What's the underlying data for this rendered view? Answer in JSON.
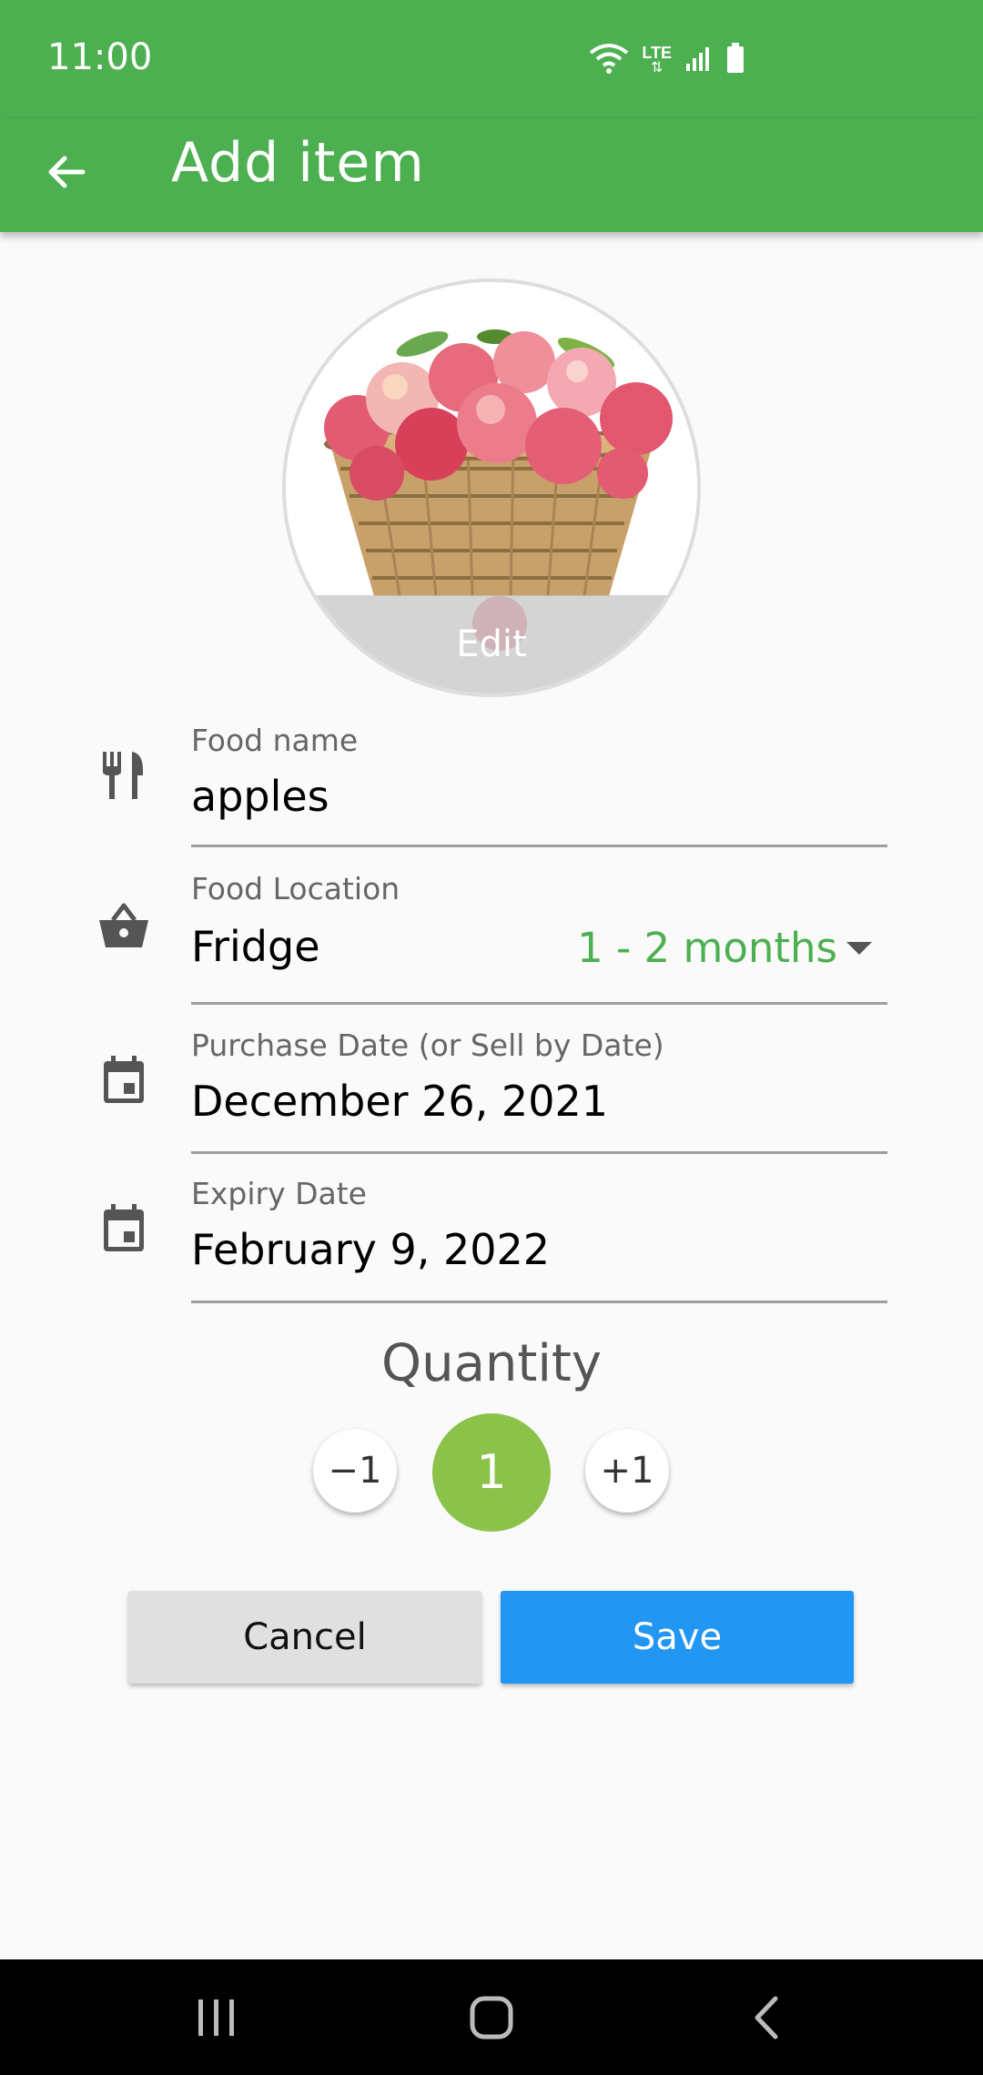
{
  "status_bar": {
    "time": "11:00",
    "network_label": "LTE",
    "icons": [
      "wifi-icon",
      "lte-data-icon",
      "signal-icon",
      "battery-icon"
    ]
  },
  "app_bar": {
    "title": "Add item",
    "back_icon": "arrow-back-icon"
  },
  "photo": {
    "edit_label": "Edit"
  },
  "fields": {
    "food_name": {
      "label": "Food name",
      "value": "apples",
      "icon": "cutlery-icon"
    },
    "food_location": {
      "label": "Food Location",
      "value": "Fridge",
      "shelf_life": "1 - 2 months",
      "icon": "basket-icon"
    },
    "purchase_date": {
      "label": "Purchase Date (or Sell by Date)",
      "value": "December 26, 2021",
      "icon": "calendar-icon"
    },
    "expiry_date": {
      "label": "Expiry Date",
      "value": "February 9, 2022",
      "icon": "calendar-icon"
    }
  },
  "quantity": {
    "title": "Quantity",
    "decrement_label": "−1",
    "value": "1",
    "increment_label": "+1"
  },
  "actions": {
    "cancel_label": "Cancel",
    "save_label": "Save"
  },
  "colors": {
    "primary": "#4caf50",
    "quantity_accent": "#8bc34a",
    "save_button": "#2196f3",
    "cancel_button": "#e0e0e0"
  },
  "nav_bar": {
    "icons": [
      "recents-icon",
      "home-icon",
      "back-icon"
    ]
  }
}
